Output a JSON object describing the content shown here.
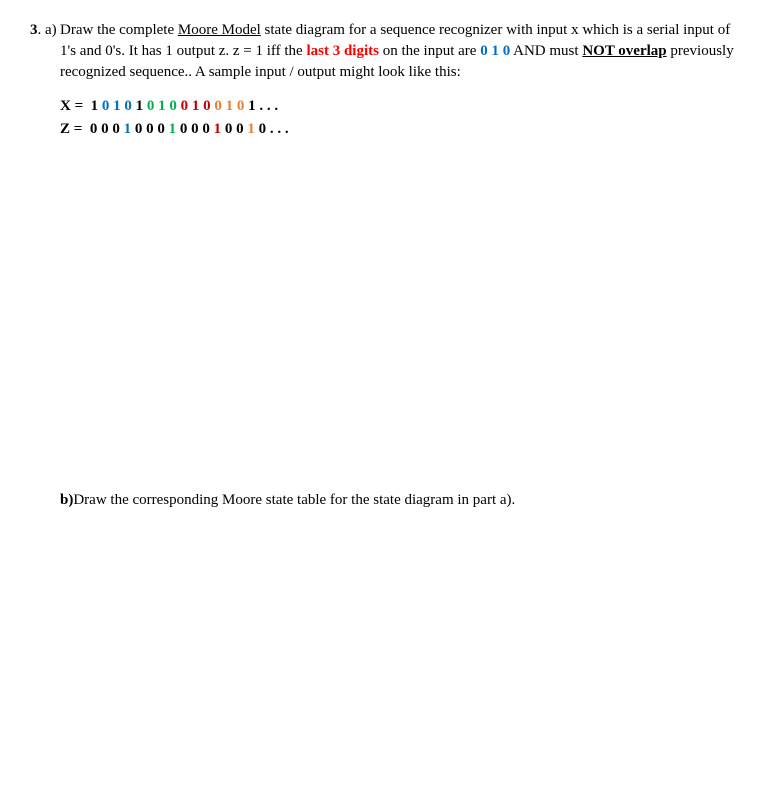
{
  "q_num": "3",
  "part_a_label": ". a)",
  "part_a": {
    "t1": "Draw the complete ",
    "moore_model": "Moore Model",
    "t2": " state diagram for a sequence recognizer with input x which is a serial input of 1's and 0's.   It has 1 output z.   z = 1 iff the ",
    "last3": "last 3 digits",
    "t3": " on the input are   ",
    "seq010": "0 1 0",
    "t4": "  AND  must ",
    "not_overlap": "NOT overlap",
    "t5": " previously recognized sequence..  A sample input / output might look like this:"
  },
  "sampleX": {
    "label": "X =  ",
    "d": [
      "1",
      " ",
      "0",
      " ",
      "1",
      " ",
      "0",
      " ",
      "1",
      " ",
      "0",
      " ",
      "1",
      " ",
      "0",
      " ",
      "0",
      " ",
      "1",
      " ",
      "0",
      " ",
      "0",
      " ",
      "1",
      " ",
      "0",
      " ",
      "1"
    ],
    "tail": " . . ."
  },
  "sampleZ": {
    "label": "Z =  ",
    "d": [
      "0",
      " ",
      "0",
      " ",
      "0",
      " ",
      "1",
      " ",
      "0",
      " ",
      "0",
      " ",
      "0",
      " ",
      "1",
      " ",
      "0",
      " ",
      "0",
      " ",
      "0",
      " ",
      "1",
      " ",
      "0",
      " ",
      "0",
      " ",
      "1",
      " ",
      "0"
    ],
    "tail": " . . ."
  },
  "part_b_label": "b)",
  "part_b_text": "  Draw the corresponding Moore state table for the state diagram in part a)."
}
